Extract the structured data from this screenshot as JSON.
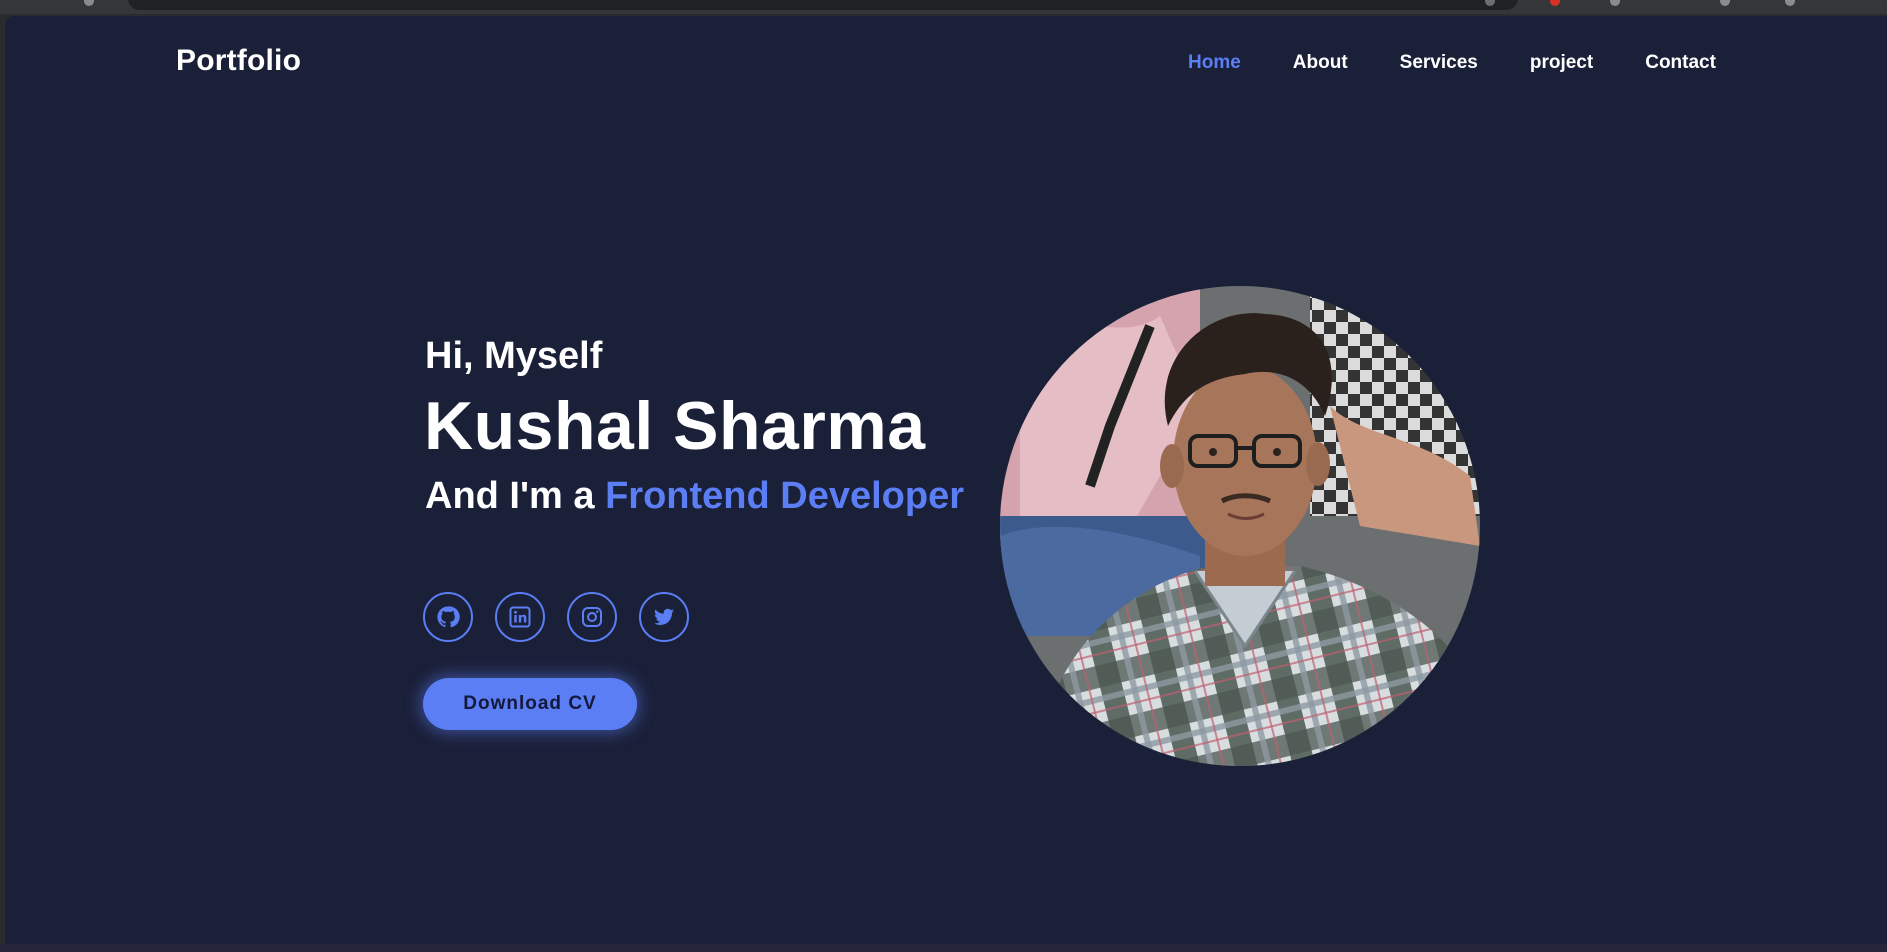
{
  "brand": {
    "logo": "Portfolio"
  },
  "nav": {
    "items": [
      {
        "label": "Home",
        "active": true
      },
      {
        "label": "About",
        "active": false
      },
      {
        "label": "Services",
        "active": false
      },
      {
        "label": "project",
        "active": false
      },
      {
        "label": "Contact",
        "active": false
      }
    ]
  },
  "hero": {
    "greeting": "Hi, Myself",
    "name": "Kushal Sharma",
    "role_prefix": "And I'm a ",
    "role_highlight": "Frontend Developer",
    "socials": [
      {
        "icon": "github-icon"
      },
      {
        "icon": "linkedin-icon"
      },
      {
        "icon": "instagram-icon"
      },
      {
        "icon": "twitter-icon"
      }
    ],
    "cta_label": "Download CV",
    "photo": "profile-photo"
  },
  "colors": {
    "background": "#1b2039",
    "accent": "#5b7ef5",
    "text": "#ffffff"
  }
}
